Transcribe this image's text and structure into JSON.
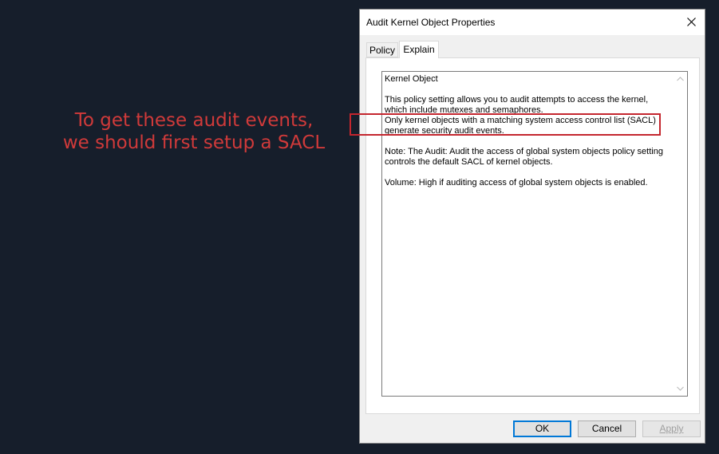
{
  "annotation": {
    "line1": "To get these audit events,",
    "line2": "we should first setup a SACL"
  },
  "dialog": {
    "title": "Audit Kernel Object Properties",
    "tabs": [
      {
        "label": "Policy",
        "active": false
      },
      {
        "label": "Explain",
        "active": true
      }
    ],
    "explain": {
      "heading": "Kernel Object",
      "para1": "This policy setting allows you to audit attempts to access the kernel, which include mutexes and semaphores.",
      "para2": "Only kernel objects with a matching system access control list (SACL) generate security audit events.",
      "para3": "Note: The Audit: Audit the access of global system objects policy setting controls the default SACL of kernel objects.",
      "para4": "Volume: High if auditing access of global system objects is enabled."
    },
    "buttons": {
      "ok": "OK",
      "cancel": "Cancel",
      "apply": "Apply"
    }
  },
  "icons": {
    "close": "close-icon",
    "scroll_up": "chevron-up-icon",
    "scroll_down": "chevron-down-icon"
  },
  "colors": {
    "background": "#161e2b",
    "annotation": "#d03a3a",
    "highlight_box": "#c4262e",
    "ok_focus": "#0078d7"
  }
}
